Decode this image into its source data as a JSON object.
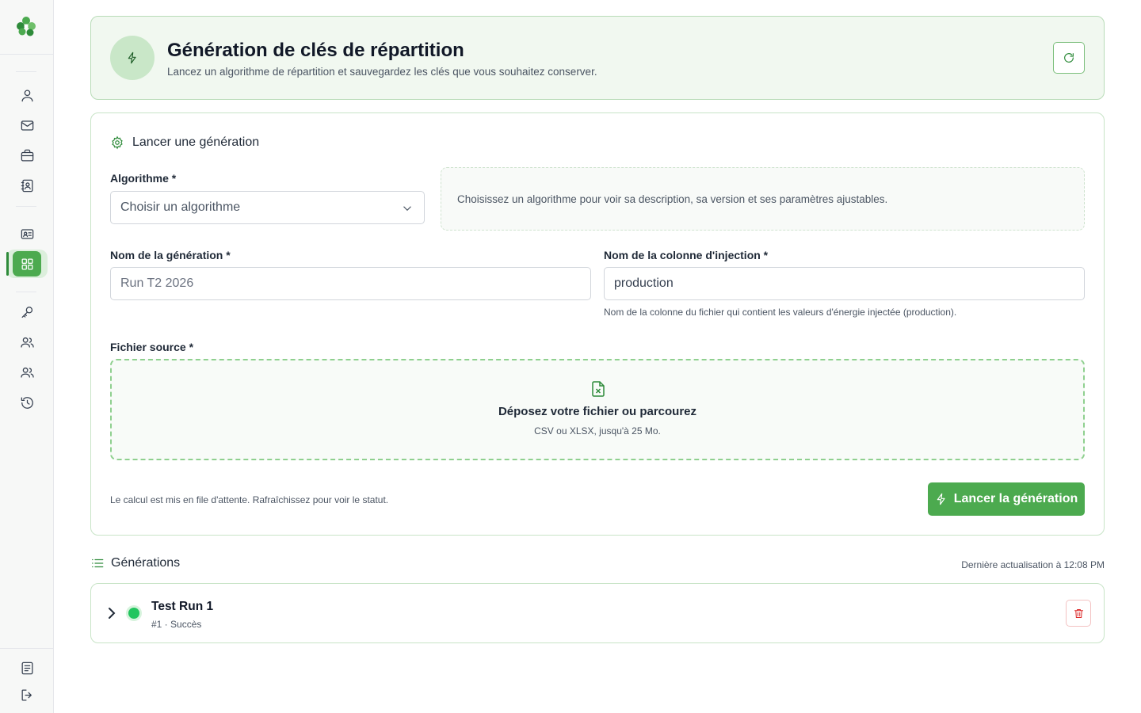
{
  "sidebar": {
    "items": [
      {
        "icon": "user-icon"
      },
      {
        "icon": "mail-icon"
      },
      {
        "icon": "briefcase-icon"
      },
      {
        "icon": "contact-book-icon"
      },
      {
        "icon": "id-card-icon"
      },
      {
        "icon": "grid-icon",
        "active": true
      },
      {
        "icon": "key-icon"
      },
      {
        "icon": "users-icon"
      },
      {
        "icon": "users-icon"
      },
      {
        "icon": "history-icon"
      },
      {
        "icon": "document-icon"
      },
      {
        "icon": "logout-icon"
      }
    ]
  },
  "header": {
    "title": "Génération de clés de répartition",
    "subtitle": "Lancez un algorithme de répartition et sauvegardez les clés que vous souhaitez conserver."
  },
  "form": {
    "section_title": "Lancer une génération",
    "algorithm": {
      "label": "Algorithme *",
      "placeholder": "Choisir un algorithme",
      "description": "Choisissez un algorithme pour voir sa description, sa version et ses paramètres ajustables."
    },
    "generation_name": {
      "label": "Nom de la génération *",
      "placeholder": "Run T2 2026",
      "value": ""
    },
    "injection_column": {
      "label": "Nom de la colonne d'injection *",
      "value": "production",
      "hint": "Nom de la colonne du fichier qui contient les valeurs d'énergie injectée (production)."
    },
    "source_file": {
      "label": "Fichier source *",
      "drop_title": "Déposez votre fichier ou parcourez",
      "drop_sub": "CSV ou XLSX, jusqu'à 25 Mo."
    },
    "footnote": "Le calcul est mis en file d'attente. Rafraîchissez pour voir le statut.",
    "submit_label": "Lancer la génération"
  },
  "generations": {
    "title": "Générations",
    "last_update": "Dernière actualisation à 12:08 PM",
    "items": [
      {
        "name": "Test Run 1",
        "meta": "#1 · Succès",
        "status_color": "#22c55e"
      }
    ]
  },
  "colors": {
    "accent": "#4caa4f",
    "accent_dark": "#2e8b3a",
    "header_bg": "#f1f8f0",
    "danger": "#dc2626"
  }
}
